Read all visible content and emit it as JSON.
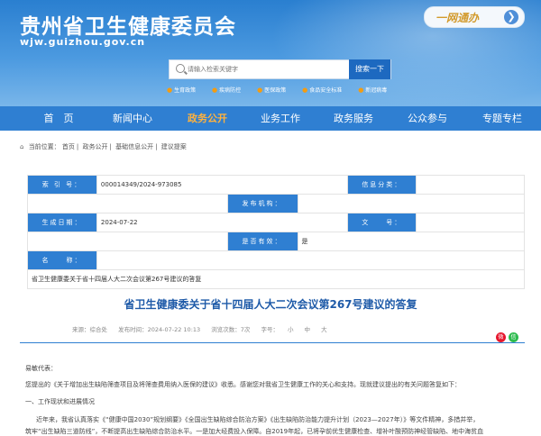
{
  "header": {
    "site_title": "贵州省卫生健康委员会",
    "site_url": "wjw.guizhou.gov.cn",
    "oneweb_label": "一网通办",
    "oneweb_arrow": "❯",
    "search_placeholder": "请输入检索关键字",
    "search_button": "搜索一下",
    "hotlinks": [
      "生育政策",
      "疾病防控",
      "医保政策",
      "食品安全标准",
      "新冠病毒"
    ]
  },
  "nav": {
    "items": [
      "首　页",
      "新闻中心",
      "政务公开",
      "业务工作",
      "政务服务",
      "公众参与",
      "专题专栏"
    ],
    "active_index": 2
  },
  "breadcrumb": {
    "prefix": "当前位置：",
    "items": [
      "首页",
      "政务公开",
      "基础信息公开",
      "建议提案"
    ]
  },
  "info_table": {
    "index_label": "索 引 号：",
    "index_value": "000014349/2024-973085",
    "category_label": "信息分类：",
    "category_value": "",
    "publisher_label": "发布机构：",
    "publisher_value": "",
    "date_label": "生成日期：",
    "date_value": "2024-07-22",
    "docno_label": "文　　号：",
    "docno_value": "",
    "valid_label": "是否有效：",
    "valid_value": "是",
    "name_label": "名　　称：",
    "name_value": "省卫生健康委关于省十四届人大二次会议第267号建议的答复"
  },
  "article": {
    "title": "省卫生健康委关于省十四届人大二次会议第267号建议的答复",
    "source": "来源：综合处",
    "publish_time": "发布时间：2024-07-22 10:13",
    "views": "浏览次数：7次",
    "font_size_prefix": "字号：",
    "font_small": "小",
    "font_medium": "中",
    "font_large": "大",
    "greeting": "易敏代表：",
    "para1": "您提出的《关于增加出生缺陷筛查项目及将筛查费用纳入医保的建议》收悉。感谢您对我省卫生健康工作的关心和支持。现就建议提出的有关问题答复如下：",
    "section1": "一、工作现状和进展情况",
    "para2": "近年来，我省认真落实《“健康中国2030”规划纲要》《全国出生缺陷综合防治方案》《出生缺陷防治能力提升计划（2023—2027年）》等文件精神，多措并举，",
    "para3": "筑牢“出生缺陷三道防线”，不断提高出生缺陷综合防治水平。一是加大经费投入保障。自2019年起，已将孕前优生健康检查、增补叶酸预防神经管缺陷、地中海贫血"
  },
  "share": {
    "weibo": "微",
    "wechat": "信"
  },
  "colors": {
    "header_blue": "#2a7fd0",
    "nav_blue": "#2f7fd2",
    "active_orange": "#ffb23e",
    "title_blue": "#1e5aa8",
    "oneweb_gold": "#d29a2c"
  }
}
